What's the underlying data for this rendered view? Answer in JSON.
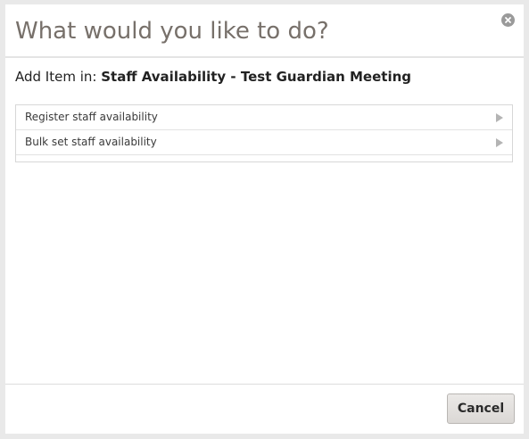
{
  "dialog": {
    "title": "What would you like to do?",
    "close_icon": "close-circle-icon",
    "context": {
      "prefix": "Add Item in:",
      "name": "Staff Availability - Test Guardian Meeting"
    },
    "items": [
      {
        "label": "Register staff availability",
        "icon": "chevron-right-icon"
      },
      {
        "label": "Bulk set staff availability",
        "icon": "chevron-right-icon"
      }
    ],
    "footer": {
      "cancel_label": "Cancel"
    }
  },
  "colors": {
    "page_background": "#e9e9e9",
    "dialog_background": "#ffffff",
    "title_text": "#77706a",
    "close_icon": "#9a9a9a",
    "arrow": "#b4b4b4",
    "button_background": "#e2dfdc"
  }
}
